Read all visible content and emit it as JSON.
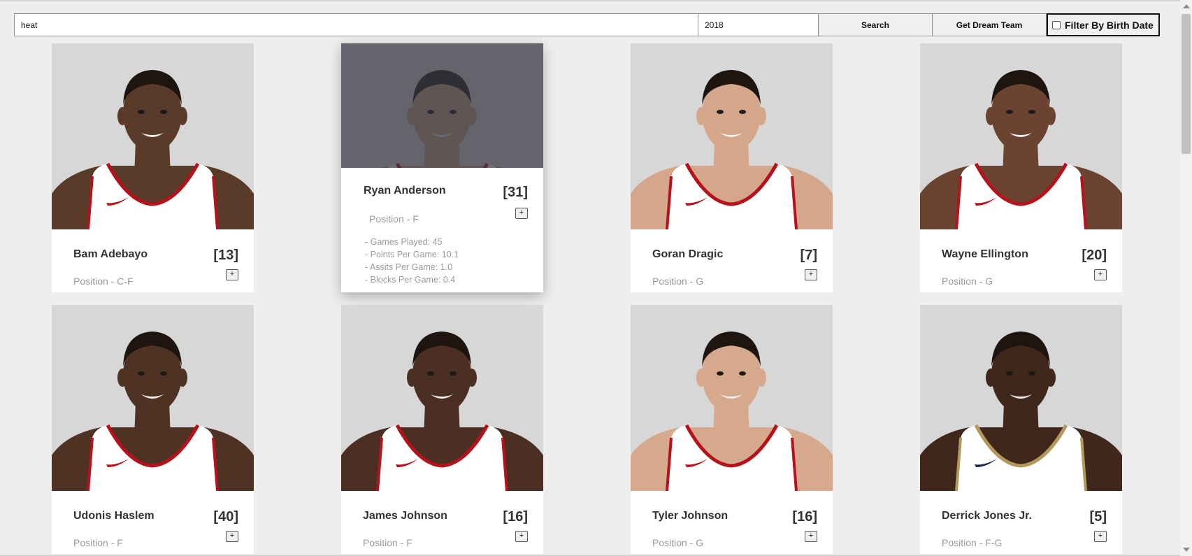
{
  "search": {
    "team_value": "heat",
    "season_value": "2018",
    "search_label": "Search",
    "dream_team_label": "Get Dream Team",
    "filter_label": "Filter By Birth Date"
  },
  "colors": {
    "background": "#eeeeee",
    "card": "#ffffff",
    "photo_bg": "#d7d7d7",
    "jersey": "#ffffff",
    "jersey_trim_heat": "#b5121b",
    "jersey_trim_pelicans": "#b4975a",
    "overlay": "#373942"
  },
  "players": [
    {
      "name": "Bam Adebayo",
      "number": "[13]",
      "position": "Position - C-F",
      "add_label": "+",
      "skin": "#5a3a28",
      "jersey": "heat"
    },
    {
      "name": "Ryan Anderson",
      "number": "[31]",
      "position": "Position - F",
      "add_label": "+",
      "skin": "#c99a80",
      "jersey": "heat",
      "hovered": true,
      "stats": [
        "- Games Played: 45",
        "- Points Per Game: 10.1",
        "- Assits Per Game: 1.0",
        "- Blocks Per Game: 0.4"
      ]
    },
    {
      "name": "Goran Dragic",
      "number": "[7]",
      "position": "Position - G",
      "add_label": "+",
      "skin": "#d4a68a",
      "jersey": "heat"
    },
    {
      "name": "Wayne Ellington",
      "number": "[20]",
      "position": "Position - G",
      "add_label": "+",
      "skin": "#6b4431",
      "jersey": "heat"
    },
    {
      "name": "Udonis Haslem",
      "number": "[40]",
      "position": "Position - F",
      "add_label": "+",
      "skin": "#4e3224",
      "jersey": "heat"
    },
    {
      "name": "James Johnson",
      "number": "[16]",
      "position": "Position - F",
      "add_label": "+",
      "skin": "#4a2f22",
      "jersey": "heat"
    },
    {
      "name": "Tyler Johnson",
      "number": "[16]",
      "position": "Position - G",
      "add_label": "+",
      "skin": "#d6a98d",
      "jersey": "heat"
    },
    {
      "name": "Derrick Jones Jr.",
      "number": "[5]",
      "position": "Position - F-G",
      "add_label": "+",
      "skin": "#3f271c",
      "jersey": "pelicans"
    }
  ]
}
